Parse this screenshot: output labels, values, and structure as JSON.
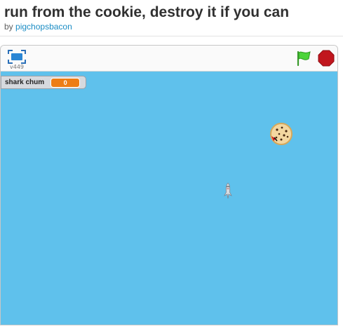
{
  "project": {
    "title": "run from the cookie, destroy it if you can",
    "by_prefix": "by",
    "author": "pigchopsbacon"
  },
  "player": {
    "version": "v449",
    "icons": {
      "fullscreen": "fullscreen-icon",
      "green_flag": "green-flag-icon",
      "stop": "stop-sign-icon"
    },
    "colors": {
      "stage_background": "#5fc1ec",
      "flag": "#3fd53a",
      "stop": "#c1161e",
      "monitor_value": "#ee7d16"
    }
  },
  "stage": {
    "variable_monitor": {
      "name": "shark chum",
      "value": "0"
    },
    "sprites": [
      "cookie",
      "shark"
    ]
  }
}
